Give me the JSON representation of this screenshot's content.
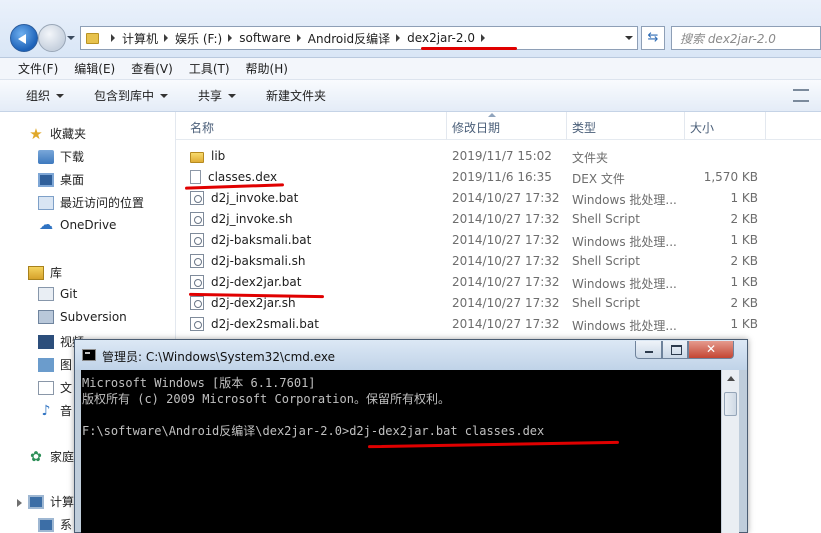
{
  "breadcrumb": {
    "items": [
      "计算机",
      "娱乐 (F:)",
      "software",
      "Android反编译",
      "dex2jar-2.0"
    ]
  },
  "search": {
    "placeholder": "搜索 dex2jar-2.0"
  },
  "menu": [
    "文件(F)",
    "编辑(E)",
    "查看(V)",
    "工具(T)",
    "帮助(H)"
  ],
  "commands": [
    {
      "label": "组织",
      "dropdown": true
    },
    {
      "label": "包含到库中",
      "dropdown": true
    },
    {
      "label": "共享",
      "dropdown": true
    },
    {
      "label": "新建文件夹",
      "dropdown": false
    }
  ],
  "nav": {
    "favorites": "收藏夹",
    "fav_items": [
      "下载",
      "桌面",
      "最近访问的位置"
    ],
    "onedrive": "OneDrive",
    "libraries": "库",
    "lib_items": [
      "Git",
      "Subversion",
      "视频",
      "图",
      "文",
      "音"
    ],
    "homegroup": "家庭",
    "computer": "计算",
    "computer_sub": "系"
  },
  "columns": {
    "name": "名称",
    "date": "修改日期",
    "type": "类型",
    "size": "大小"
  },
  "files": [
    {
      "name": "lib",
      "date": "2019/11/7 15:02",
      "type": "文件夹",
      "size": "",
      "icon": "folder-icon"
    },
    {
      "name": "classes.dex",
      "date": "2019/11/6 16:35",
      "type": "DEX 文件",
      "size": "1,570 KB",
      "icon": "file-icon"
    },
    {
      "name": "d2j_invoke.bat",
      "date": "2014/10/27 17:32",
      "type": "Windows 批处理...",
      "size": "1 KB",
      "icon": "batch-file-icon"
    },
    {
      "name": "d2j_invoke.sh",
      "date": "2014/10/27 17:32",
      "type": "Shell Script",
      "size": "2 KB",
      "icon": "shell-script-icon"
    },
    {
      "name": "d2j-baksmali.bat",
      "date": "2014/10/27 17:32",
      "type": "Windows 批处理...",
      "size": "1 KB",
      "icon": "batch-file-icon"
    },
    {
      "name": "d2j-baksmali.sh",
      "date": "2014/10/27 17:32",
      "type": "Shell Script",
      "size": "2 KB",
      "icon": "shell-script-icon"
    },
    {
      "name": "d2j-dex2jar.bat",
      "date": "2014/10/27 17:32",
      "type": "Windows 批处理...",
      "size": "1 KB",
      "icon": "batch-file-icon"
    },
    {
      "name": "d2j-dex2jar.sh",
      "date": "2014/10/27 17:32",
      "type": "Shell Script",
      "size": "2 KB",
      "icon": "shell-script-icon"
    },
    {
      "name": "d2j-dex2smali.bat",
      "date": "2014/10/27 17:32",
      "type": "Windows 批处理...",
      "size": "1 KB",
      "icon": "batch-file-icon"
    }
  ],
  "cmd": {
    "title": "管理员: C:\\Windows\\System32\\cmd.exe",
    "lines": [
      "Microsoft Windows [版本 6.1.7601]",
      "版权所有 (c) 2009 Microsoft Corporation。保留所有权利。",
      "",
      "F:\\software\\Android反编译\\dex2jar-2.0>d2j-dex2jar.bat classes.dex"
    ]
  },
  "colors": {
    "annotation_red": "#e00000",
    "console_bg": "#000000",
    "console_fg": "#c0c0c0"
  }
}
